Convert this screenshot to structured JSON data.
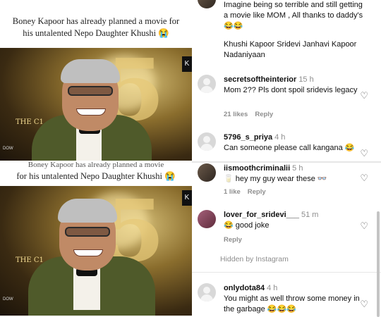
{
  "posts": {
    "top_caption": "Boney Kapoor has already planned a movie for his untalented Nepo Daughter Khushi 😭",
    "bottom_caption_overlap": "Boney Kapoor has already planned a movie",
    "bottom_caption": "for his untalented Nepo Daughter Khushi 😭",
    "logo_text": "THE C1",
    "mic_text": "DOW",
    "corner_icon": "K"
  },
  "comments_top": {
    "continued_text": "Imagine being so terrible and still getting a movie like MOM , All thanks to daddy's 😂😂",
    "continued_text2": "Khushi Kapoor Sridevi Janhavi Kapoor Nadaniyaan",
    "items": [
      {
        "username": "secretsoftheinterior",
        "time": "15 h",
        "text": "Mom 2?? Pls dont spoil sridevis legacy",
        "likes": "21 likes",
        "reply": "Reply",
        "avatar": "default-avatar-icon"
      },
      {
        "username": "5796_s_priya",
        "time": "4 h",
        "text": "Can someone please call kangana 😂",
        "avatar": "default-avatar-icon"
      }
    ]
  },
  "comments_bottom": {
    "items": [
      {
        "username": "iismoothcriminalii",
        "time": "5 h",
        "text": "🥛 hey my guy wear these 👓",
        "likes": "1 like",
        "reply": "Reply",
        "avatar": "photo-avatar"
      },
      {
        "username": "lover_for_sridevi___",
        "time": "51 m",
        "text": "😂 good joke",
        "reply": "Reply",
        "avatar": "photo-avatar"
      },
      {
        "username": "onlydota84",
        "time": "4 h",
        "text": "You might as well throw some money in the garbage 😂😂😂",
        "avatar": "default-avatar-icon"
      }
    ],
    "hidden_note": "Hidden by Instagram"
  },
  "icons": {
    "like": "heart-outline-icon"
  }
}
